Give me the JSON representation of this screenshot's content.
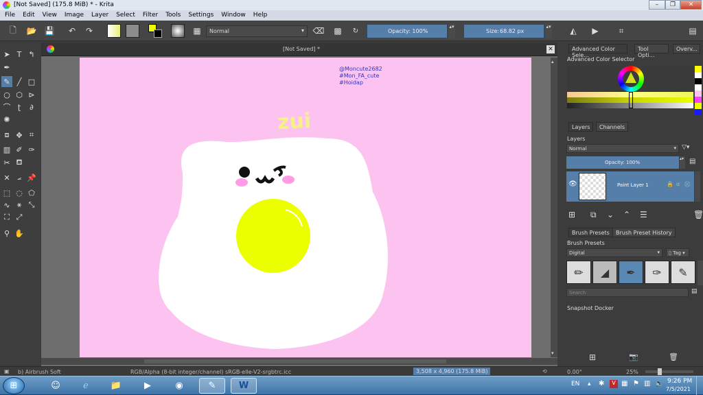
{
  "window": {
    "title": "[Not Saved]  (175.8 MiB)  * - Krita"
  },
  "menu": [
    "File",
    "Edit",
    "View",
    "Image",
    "Layer",
    "Select",
    "Filter",
    "Tools",
    "Settings",
    "Window",
    "Help"
  ],
  "toolbar": {
    "blend_mode": "Normal",
    "opacity": "Opacity: 100%",
    "size_label": "Size:",
    "size_value": "68.82 px"
  },
  "document": {
    "tab_title": "[Not Saved]  *"
  },
  "canvas_text": {
    "handles": [
      "@Moncute2682",
      "#Mon_FA_cute",
      "#Hoidap"
    ],
    "doodle": "zui"
  },
  "dock": {
    "tabs": [
      "Advanced Color Sele...",
      "Tool Opti...",
      "Overv..."
    ],
    "color_selector_title": "Advanced Color Selector",
    "layers_tabs": [
      "Layers",
      "Channels"
    ],
    "layers_title": "Layers",
    "layers_blend": "Normal",
    "layers_opacity": "Opacity:  100%",
    "layer_name": "Paint Layer 1",
    "presets_tabs": [
      "Brush Presets",
      "Brush Preset History"
    ],
    "presets_title": "Brush Presets",
    "preset_filter": "Digital",
    "tag_label": "Tag",
    "search_placeholder": "Search",
    "snapshot_title": "Snapshot Docker"
  },
  "status": {
    "brush": "b) Airbrush Soft",
    "color_info": "RGB/Alpha (8-bit integer/channel)  sRGB-elle-V2-srgbtrc.icc",
    "dims": "3,508 x 4,960 (175.8 MiB)",
    "rotation": "0.00°",
    "zoom": "25%"
  },
  "taskbar": {
    "lang": "EN",
    "time": "9:26 PM",
    "date": "7/5/2021"
  },
  "colors": {
    "canvas_bg": "#fcc3f1",
    "yolk": "#ecff00",
    "accent": "#557fa8"
  }
}
